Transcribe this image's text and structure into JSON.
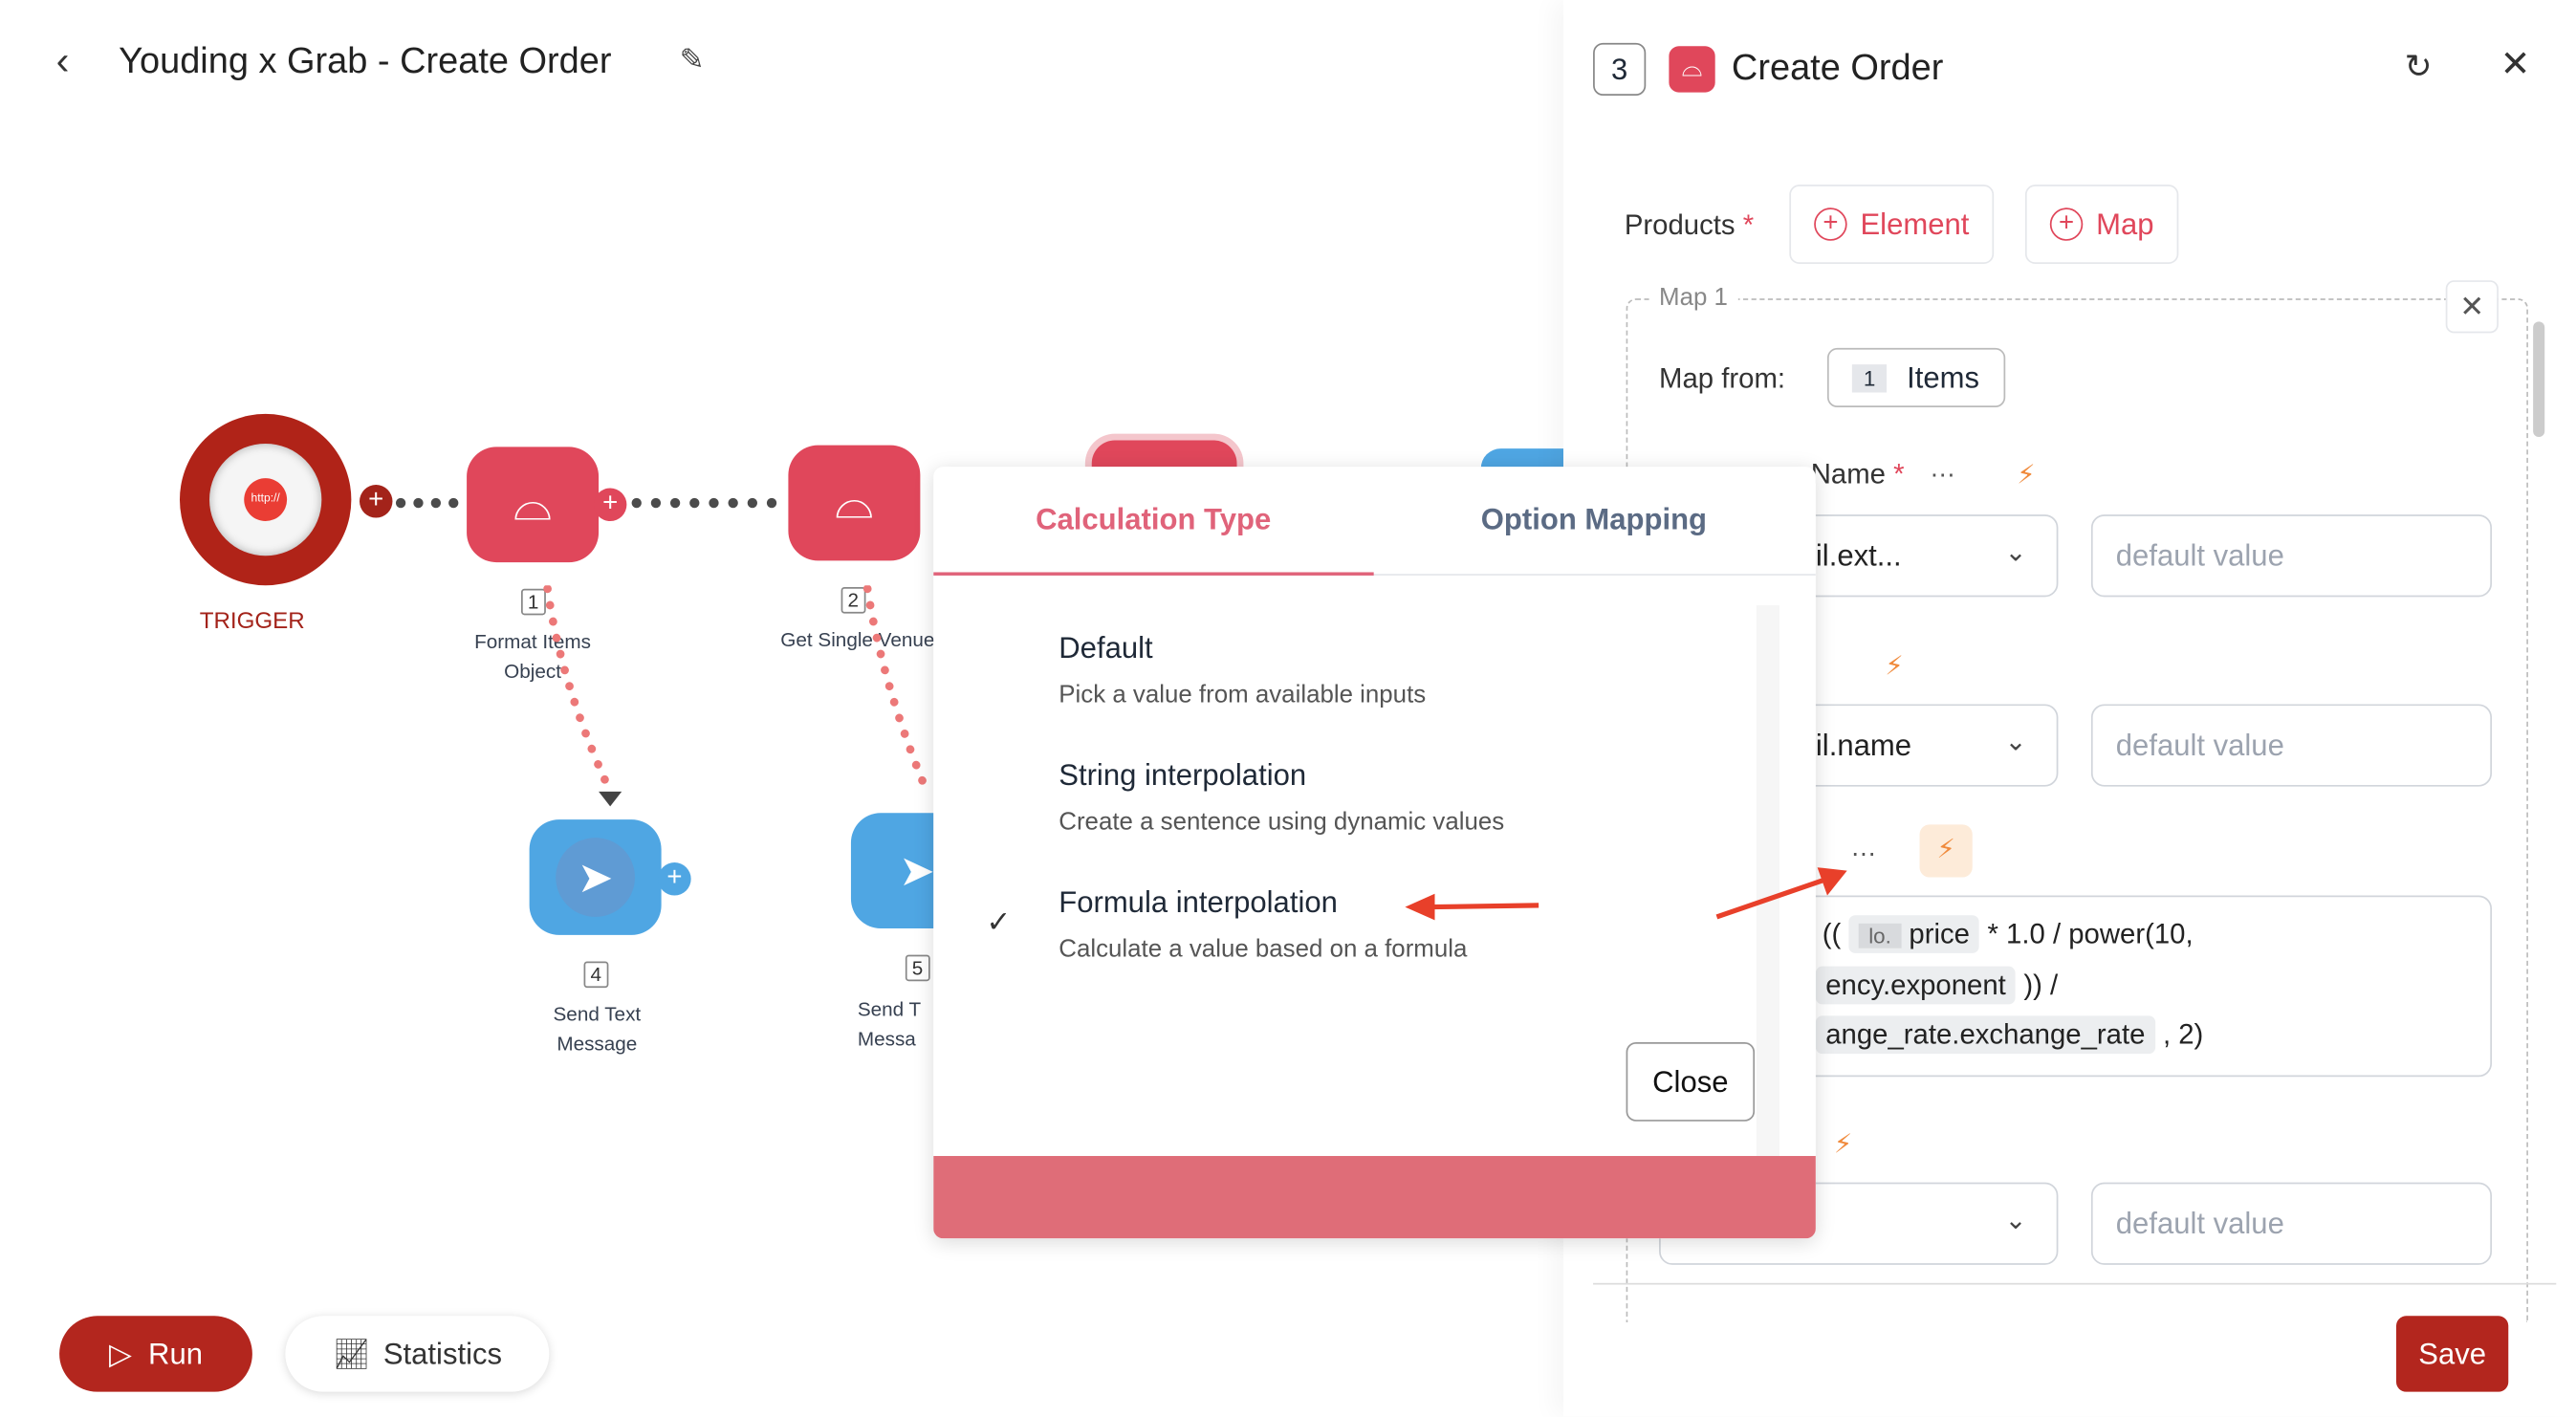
{
  "header": {
    "title": "Youding x Grab - Create Order",
    "back_icon": "chevron-left-icon",
    "edit_icon": "pencil-icon"
  },
  "canvas": {
    "trigger": {
      "label": "TRIGGER",
      "icon_text": "http://"
    },
    "nodes": [
      {
        "num": "1",
        "label_lines": [
          "Format Items",
          "Object"
        ],
        "icon": "bell-icon",
        "color": "#e0475b"
      },
      {
        "num": "2",
        "label_lines": [
          "Get Single Venue"
        ],
        "icon": "bell-icon",
        "color": "#e0475b"
      },
      {
        "num": "4",
        "label_lines": [
          "Send Text",
          "Message"
        ],
        "icon": "telegram-icon",
        "color": "#4fa6e3"
      },
      {
        "num": "5",
        "label_lines": [
          "Send T",
          "Messa"
        ],
        "icon": "telegram-icon",
        "color": "#4fa6e3"
      }
    ]
  },
  "footer": {
    "run_label": "Run",
    "statistics_label": "Statistics"
  },
  "panel": {
    "step_number": "3",
    "title": "Create Order",
    "products_label": "Products",
    "required_mark": "*",
    "element_button": "Element",
    "map_button": "Map",
    "map_title": "Map 1",
    "map_from_label": "Map from:",
    "map_from_num": "1",
    "map_from_value": "Items",
    "field1_label": "Name",
    "field1_value": "il.ext...",
    "field2_value": "il.name",
    "default_placeholder": "default value",
    "formula": {
      "open": "((",
      "chip1_prefix": "lo.",
      "chip1": "price",
      "op1": "* 1.0  / power(10,",
      "chip2": "ency.exponent",
      "op2": ")) /",
      "chip3": "ange_rate.exchange_rate",
      "op3": ", 2)"
    },
    "more_icon": "…",
    "save_label": "Save"
  },
  "popup": {
    "tabs": [
      {
        "label": "Calculation Type",
        "active": true
      },
      {
        "label": "Option Mapping",
        "active": false
      }
    ],
    "options": [
      {
        "title": "Default",
        "desc": "Pick a value from available inputs",
        "selected": false
      },
      {
        "title": "String interpolation",
        "desc": "Create a sentence using dynamic values",
        "selected": false
      },
      {
        "title": "Formula interpolation",
        "desc": "Calculate a value based on a formula",
        "selected": true
      }
    ],
    "close_label": "Close"
  },
  "colors": {
    "accent": "#e0475b",
    "trigger": "#b02318",
    "telegram": "#4fa6e3",
    "save": "#b3261e",
    "bolt": "#f08a3c",
    "annotation_arrow": "#e8402a"
  }
}
